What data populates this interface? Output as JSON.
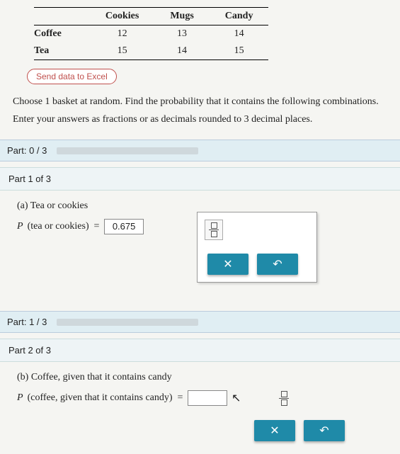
{
  "table": {
    "headers": [
      "",
      "Cookies",
      "Mugs",
      "Candy"
    ],
    "rows": [
      {
        "label": "Coffee",
        "values": [
          12,
          13,
          14
        ]
      },
      {
        "label": "Tea",
        "values": [
          15,
          14,
          15
        ]
      }
    ]
  },
  "send_button": "Send data to Excel",
  "prompt_line1_a": "Choose ",
  "prompt_line1_num": "1",
  "prompt_line1_b": " basket at random. Find the probability that it contains the following combinations.",
  "prompt_line2_a": "Enter your answers as fractions or as decimals rounded to ",
  "prompt_line2_num": "3",
  "prompt_line2_b": " decimal places.",
  "part0": {
    "label": "Part: 0 / 3",
    "progress_pct": 0
  },
  "part1_header": "Part 1 of 3",
  "q_a": {
    "label": "(a) Tea or cookies",
    "P": "P",
    "desc": "(tea or cookies)",
    "equals": "=",
    "value": "0.675"
  },
  "buttons": {
    "times": "✕",
    "undo": "↶"
  },
  "part1": {
    "label": "Part: 1 / 3",
    "progress_pct": 33
  },
  "part2_header": "Part 2 of 3",
  "q_b": {
    "label": "(b) Coffee, given that it contains candy",
    "P": "P",
    "desc": "(coffee, given that it contains candy)",
    "equals": "=",
    "value": ""
  },
  "cursor": "↖"
}
